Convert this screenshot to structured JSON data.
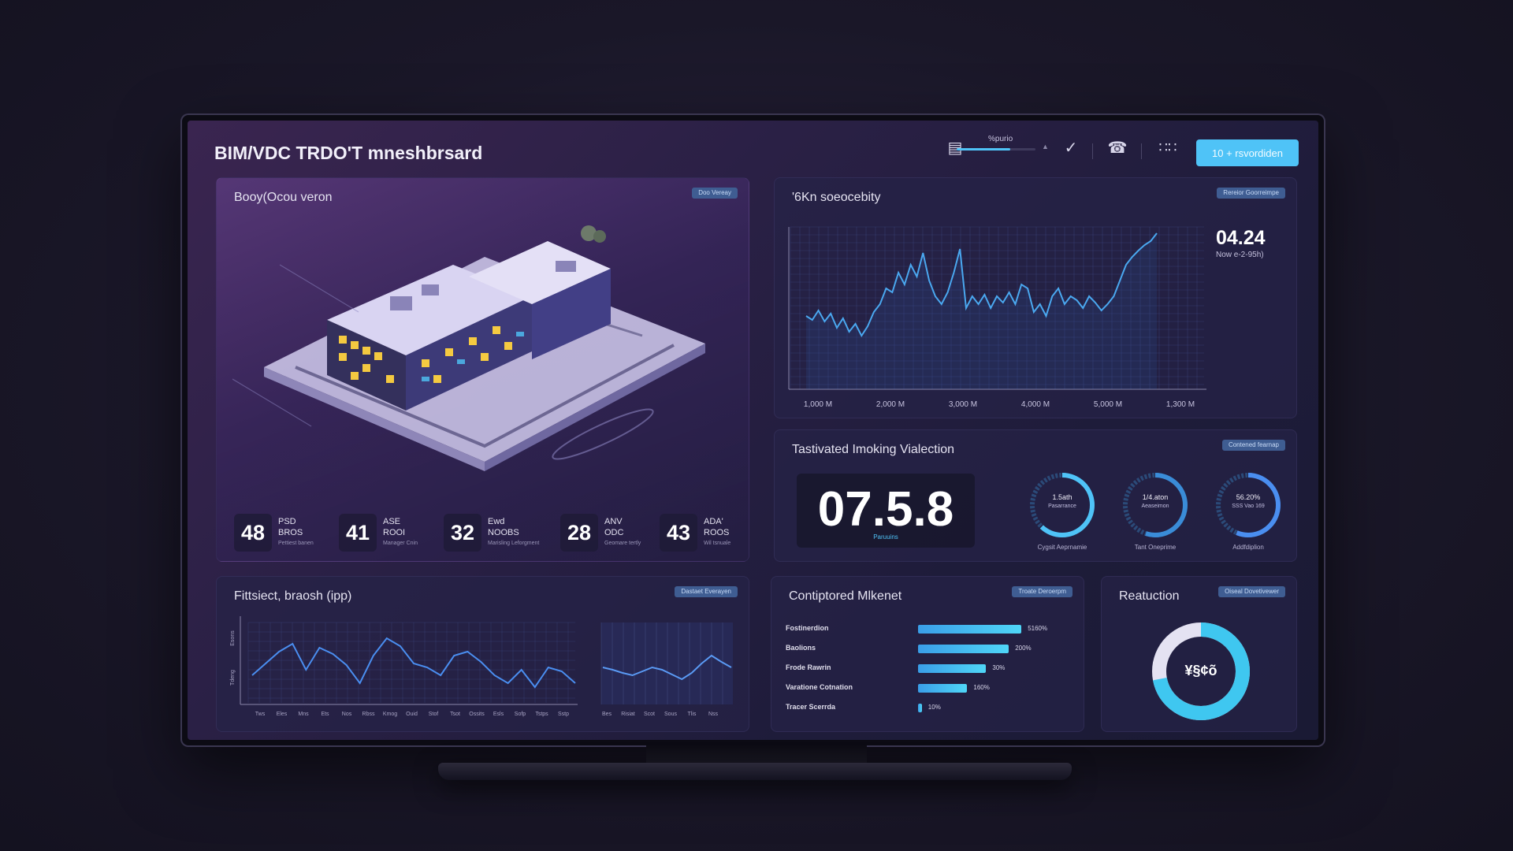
{
  "header": {
    "title": "BIM/VDC TRDO'T mneshbrsard",
    "zoom_label": "%purio",
    "zoom_value": 0.68,
    "primary_button": "10 + rsvordiden",
    "icons": [
      "image-icon",
      "chevron-up-icon",
      "pen-check-icon",
      "phone-icon",
      "grid-icon"
    ]
  },
  "model_panel": {
    "title": "Booy(Ocou veron",
    "pill": "Doo Vereay",
    "kpis": [
      {
        "value": "48",
        "line1": "PSD",
        "line2": "BROS",
        "sub": "Pettiest banen"
      },
      {
        "value": "41",
        "line1": "ASE",
        "line2": "ROOI",
        "sub": "Manager Cnin"
      },
      {
        "value": "32",
        "line1": "Ewd",
        "line2": "NOOBS",
        "sub": "Marisling Leforgment"
      },
      {
        "value": "28",
        "line1": "ANV",
        "line2": "ODC",
        "sub": "Geomare tertly"
      },
      {
        "value": "43",
        "line1": "ADA'",
        "line2": "ROOS",
        "sub": "Wil tsnuale"
      }
    ]
  },
  "line_panel": {
    "title": "'6Kn soeocebity",
    "pill": "Rereior Goorreimpe",
    "big_value": "04.24",
    "big_sub": "Now e-2-95h)",
    "x_ticks": [
      "1,000 M",
      "2,000 M",
      "3,000 M",
      "4,000 M",
      "5,000 M",
      "1,300 M"
    ],
    "accent": "#4aa8f0"
  },
  "track_panel": {
    "title": "Tastivated Imoking Vialection",
    "pill": "Contened fearnap",
    "big_value": "07.5.8",
    "big_sub": "Paruuins",
    "rings": [
      {
        "line1": "1.5ath",
        "line2": "Pasarrance",
        "caption": "Cygsit Aeprnamie",
        "value": 0.62
      },
      {
        "line1": "1/4.aton",
        "line2": "Aeaseimon",
        "caption": "Tant Oneprime",
        "value": 0.55
      },
      {
        "line1": "56.20%",
        "line2": "SSS Vao 169",
        "caption": "Addfdiplion",
        "value": 0.562
      }
    ]
  },
  "trend_panel": {
    "title": "Fittsiect, braosh (ipp)",
    "pill": "Dastaet Everayen",
    "y_labels": [
      "Esons",
      "Tdeng"
    ],
    "x_ticks_left": [
      "Tws",
      "Eles",
      "Mns",
      "Ets",
      "Nos",
      "Rbss",
      "Kmog",
      "Ouid",
      "Stof",
      "Tsot",
      "Ossits",
      "Esls",
      "Sofp",
      "Tstps",
      "Sstp"
    ],
    "x_ticks_right": [
      "Bes",
      "Risiat",
      "Scot",
      "Sous",
      "Tlis",
      "Nss"
    ]
  },
  "bars_panel": {
    "title": "Contiptored Mlkenet",
    "pill": "Troate Deroerpm",
    "rows": [
      {
        "label": "Fostinerdion",
        "value": "5160%",
        "fill": 0.82
      },
      {
        "label": "Baolions",
        "value": "200%",
        "fill": 0.72
      },
      {
        "label": "Frode Rawrin",
        "value": "30%",
        "fill": 0.54
      },
      {
        "label": "Varatione Cotnation",
        "value": "160%",
        "fill": 0.39
      },
      {
        "label": "Tracer Scerrda",
        "value": "10%",
        "fill": 0.03
      }
    ]
  },
  "donut_panel": {
    "title": "Reatuction",
    "pill": "Oiseal Dovetivewer",
    "center": "¥§¢õ",
    "value": 0.72
  }
}
